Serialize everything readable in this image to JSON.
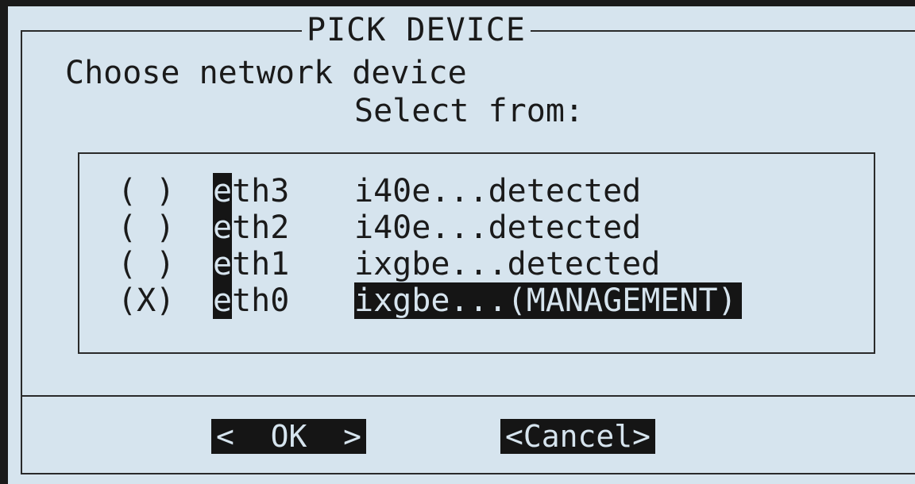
{
  "dialog": {
    "title": "PICK DEVICE",
    "prompt": "Choose network device",
    "subprompt": "Select from:"
  },
  "devices": [
    {
      "radio": "( )",
      "first": "e",
      "rest": "th3",
      "desc": "i40e...detected",
      "selected": false
    },
    {
      "radio": "( )",
      "first": "e",
      "rest": "th2",
      "desc": "i40e...detected",
      "selected": false
    },
    {
      "radio": "( )",
      "first": "e",
      "rest": "th1",
      "desc": "ixgbe...detected",
      "selected": false
    },
    {
      "radio": "(X)",
      "first": "e",
      "rest": "th0",
      "desc": "ixgbe...(MANAGEMENT)",
      "selected": true
    }
  ],
  "buttons": {
    "ok": "<  OK  >",
    "cancel": "<Cancel>"
  },
  "colors": {
    "background": "#d6e4ee",
    "highlight": "#151515",
    "text": "#1a1a1a"
  }
}
